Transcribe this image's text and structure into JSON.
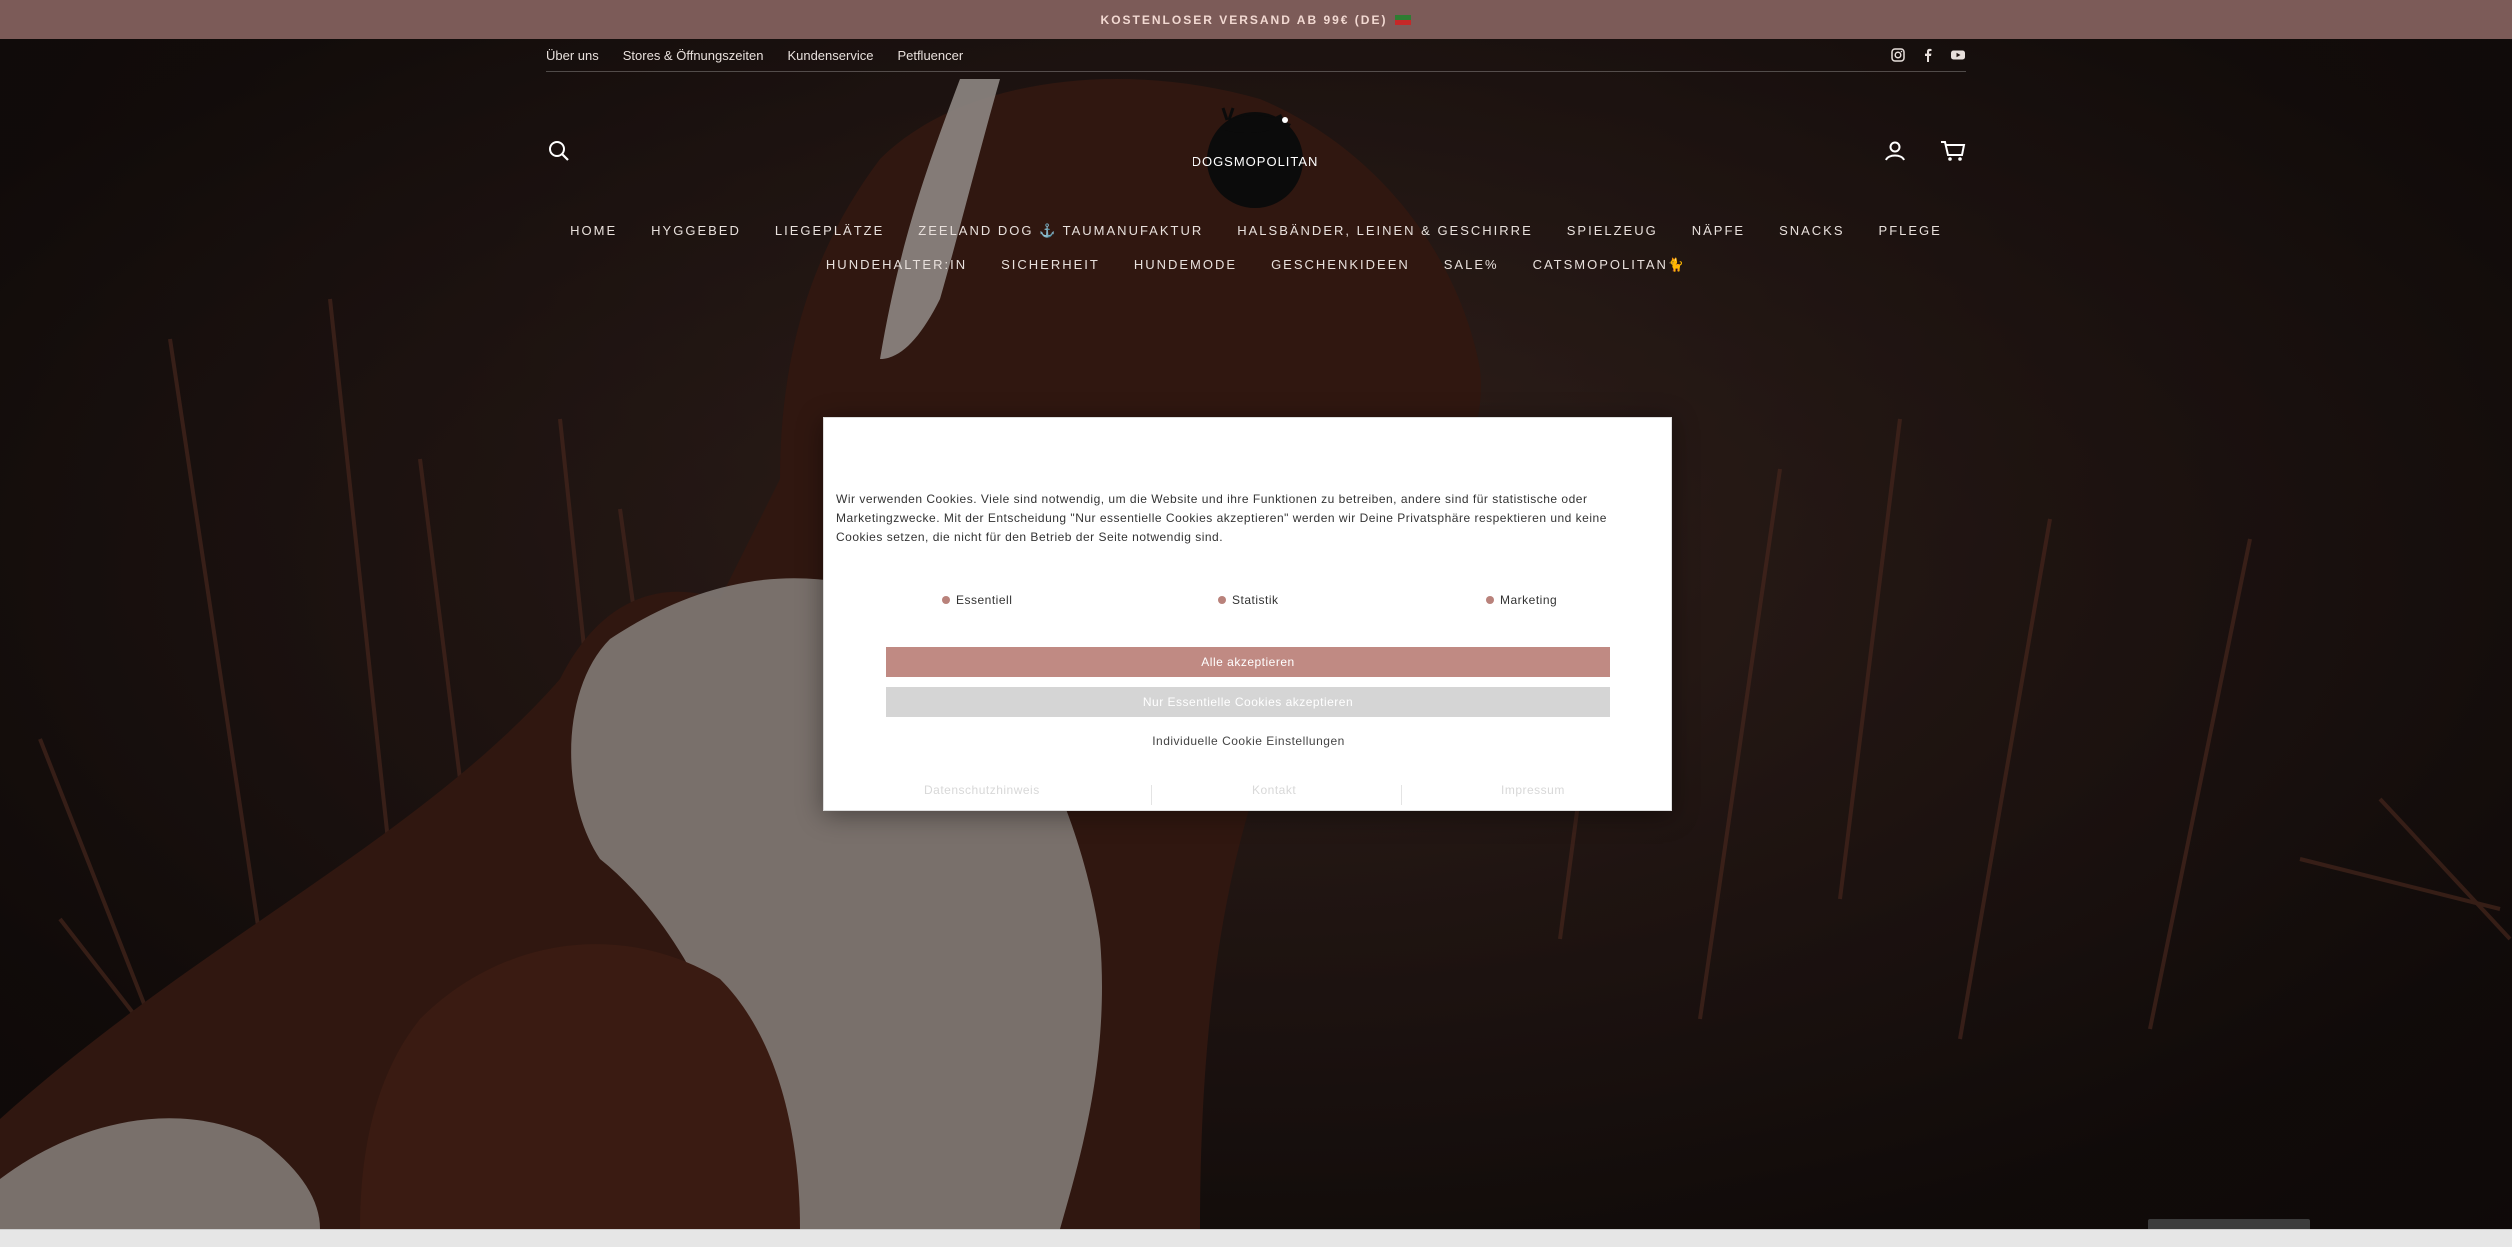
{
  "announcement": {
    "text": "KOSTENLOSER VERSAND AB 99€ (DE)"
  },
  "topbar": {
    "links": [
      "Über uns",
      "Stores & Öffnungszeiten",
      "Kundenservice",
      "Petfluencer"
    ],
    "social": [
      "instagram-icon",
      "facebook-icon",
      "youtube-icon"
    ]
  },
  "logo": {
    "text": "DOGSMOPOLITAN"
  },
  "nav": {
    "row1": [
      "HOME",
      "HYGGEBED",
      "LIEGEPLÄTZE",
      "ZEELAND DOG ⚓ TAUMANUFAKTUR",
      "HALSBÄNDER, LEINEN & GESCHIRRE",
      "SPIELZEUG",
      "NÄPFE",
      "SNACKS",
      "PFLEGE"
    ],
    "row2": [
      "HUNDEHALTER:IN",
      "SICHERHEIT",
      "HUNDEMODE",
      "GESCHENKIDEEN",
      "SALE%",
      "CATSMOPOLITAN🐈"
    ]
  },
  "cookie_modal": {
    "text": "Wir verwenden Cookies. Viele sind notwendig, um die Website und ihre Funktionen zu betreiben, andere sind für statistische oder Marketingzwecke. Mit der Entscheidung \"Nur essentielle Cookies akzeptieren\" werden wir Deine Privatsphäre respektieren und keine Cookies setzen, die nicht für den Betrieb der Seite notwendig sind.",
    "checks": [
      "Essentiell",
      "Statistik",
      "Marketing"
    ],
    "accept_all": "Alle akzeptieren",
    "accept_essential": "Nur Essentielle Cookies akzeptieren",
    "individual": "Individuelle Cookie Einstellungen",
    "footer": [
      "Datenschutzhinweis",
      "Kontakt",
      "Impressum"
    ]
  },
  "colors": {
    "announcement_bg": "#7c5b58",
    "accent": "#c08a83",
    "secondary_button": "#d5d5d5"
  }
}
